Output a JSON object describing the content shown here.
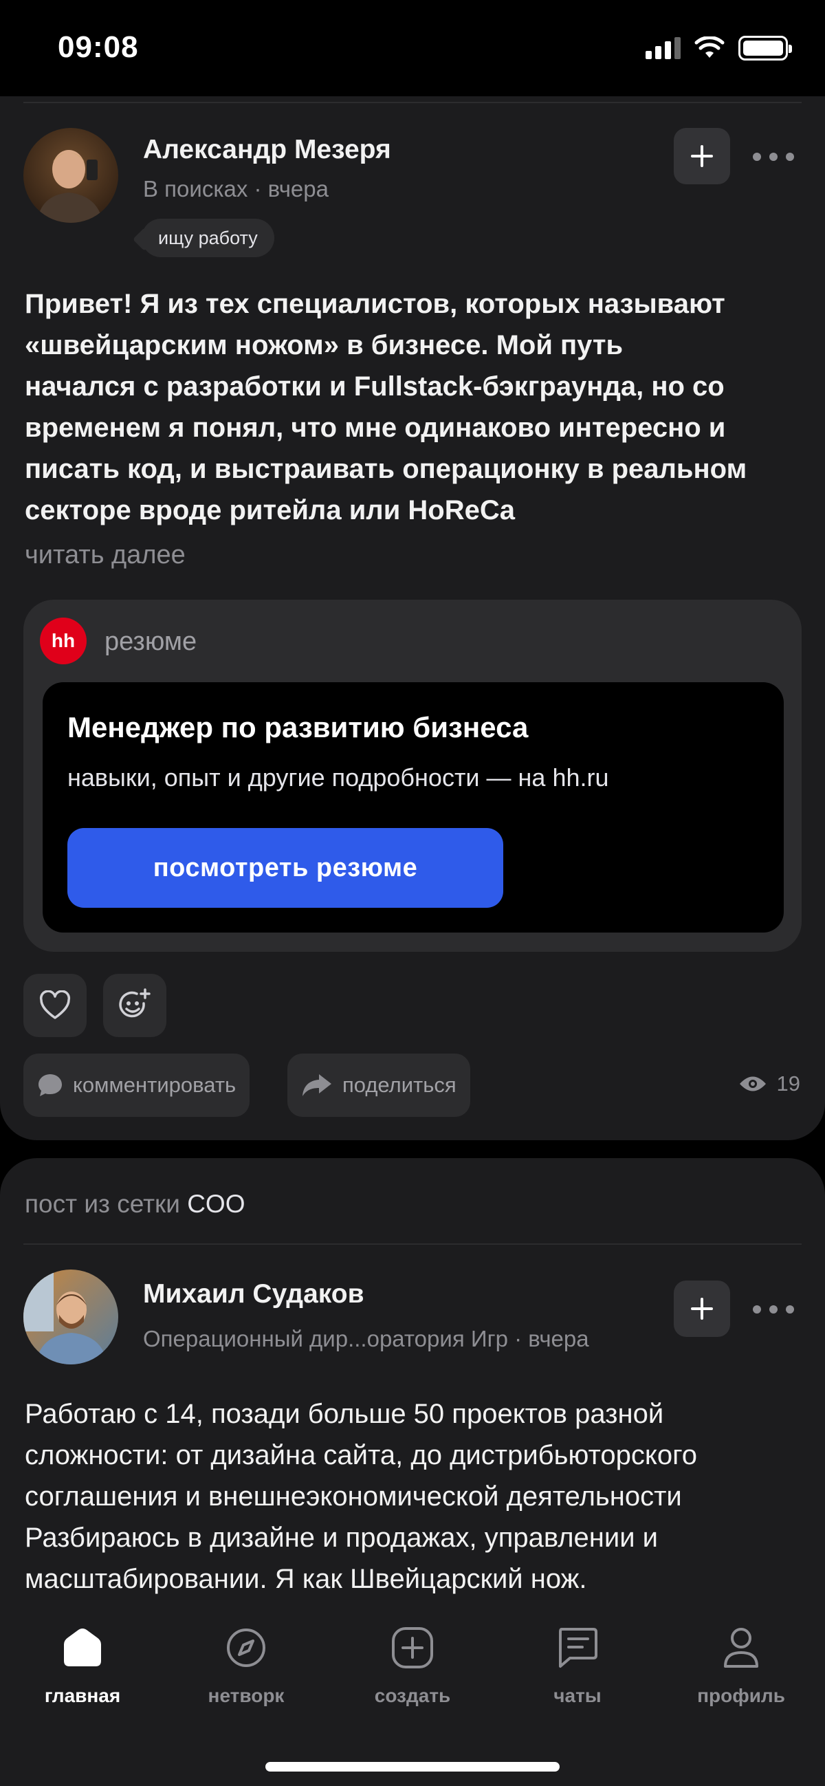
{
  "status_bar": {
    "time": "09:08"
  },
  "post1": {
    "author": {
      "name": "Александр Мезеря",
      "meta": "В поисках · вчера"
    },
    "status_chip": "ищу работу",
    "text_lines": [
      "Привет! Я из тех специалистов, которых называют",
      "«швейцарским ножом» в бизнесе. Мой путь",
      "начался с разработки и Fullstack-бэкграунда, но со",
      "временем я понял, что мне одинаково интересно и",
      "писать код, и выстраивать операционку в реальном",
      "секторе вроде ритейла или HoReCa"
    ],
    "read_more": "читать далее",
    "resume": {
      "logo_text": "hh",
      "label": "резюме",
      "title": "Менеджер по развитию бизнеса",
      "subtitle": "навыки, опыт и другие подробности — на hh.ru",
      "button": "посмотреть резюме"
    },
    "actions": {
      "comment": "комментировать",
      "share": "поделиться",
      "views": "19"
    }
  },
  "post2": {
    "header_prefix": "пост из сетки",
    "header_network": "COO",
    "author": {
      "name": "Михаил Судаков",
      "meta": "Операционный дир...оратория Игр · вчера"
    },
    "text_lines": [
      "Работаю с 14, позади больше 50 проектов разной",
      "сложности: от дизайна сайта, до дистрибьюторского",
      "соглашения и внешнеэкономической деятельности",
      "Разбираюсь в дизайне и продажах, управлении и",
      "масштабировании. Я как Швейцарский нож."
    ]
  },
  "tabs": [
    {
      "label": "главная",
      "icon": "home-icon",
      "active": true
    },
    {
      "label": "нетворк",
      "icon": "compass-icon",
      "active": false
    },
    {
      "label": "создать",
      "icon": "plus-square-icon",
      "active": false
    },
    {
      "label": "чаты",
      "icon": "chat-icon",
      "active": false
    },
    {
      "label": "профиль",
      "icon": "person-icon",
      "active": false
    }
  ],
  "colors": {
    "accent_button": "#2f5bea",
    "hh_brand": "#e0001a",
    "card_bg": "#1c1c1e"
  }
}
